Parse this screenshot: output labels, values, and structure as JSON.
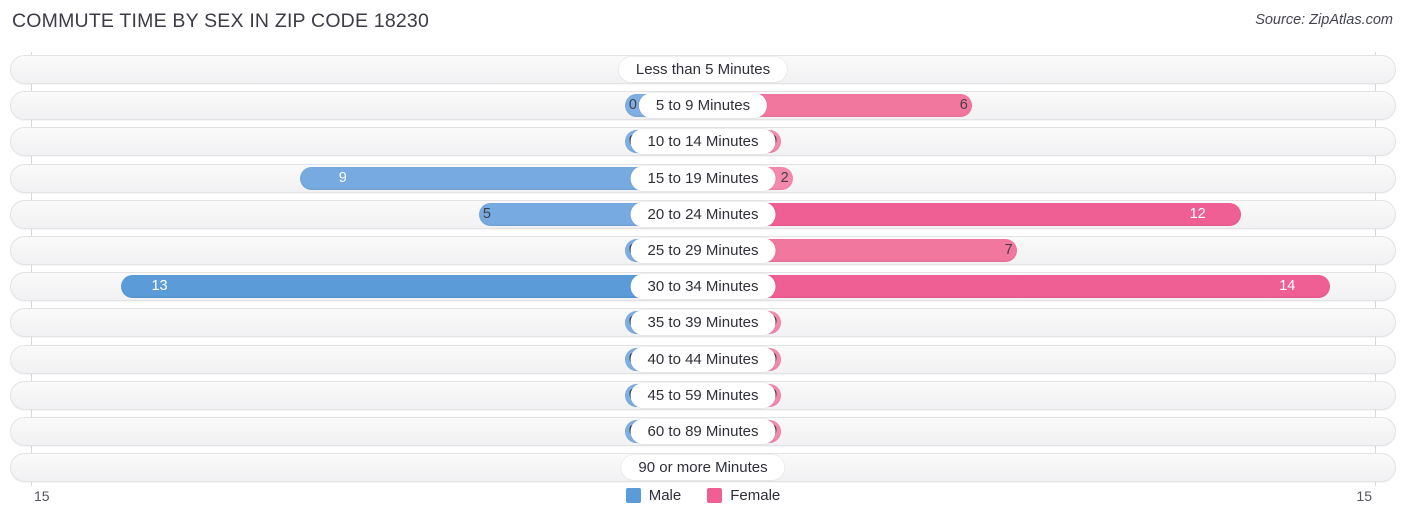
{
  "header": {
    "title": "COMMUTE TIME BY SEX IN ZIP CODE 18230",
    "source": "Source: ZipAtlas.com"
  },
  "legend": {
    "male_label": "Male",
    "female_label": "Female",
    "male_color": "#5b9bd8",
    "female_color": "#ef5f93"
  },
  "axis": {
    "left_max": "15",
    "right_max": "15",
    "max_value": 15
  },
  "chart_data": {
    "type": "bar",
    "title": "COMMUTE TIME BY SEX IN ZIP CODE 18230",
    "subtitle": "Source: ZipAtlas.com",
    "orientation": "horizontal-diverging",
    "xlabel": "",
    "ylabel": "",
    "xlim": [
      15,
      15
    ],
    "grid": false,
    "legend_position": "bottom-center",
    "categories": [
      "Less than 5 Minutes",
      "5 to 9 Minutes",
      "10 to 14 Minutes",
      "15 to 19 Minutes",
      "20 to 24 Minutes",
      "25 to 29 Minutes",
      "30 to 34 Minutes",
      "35 to 39 Minutes",
      "40 to 44 Minutes",
      "45 to 59 Minutes",
      "60 to 89 Minutes",
      "90 or more Minutes"
    ],
    "series": [
      {
        "name": "Male",
        "values": [
          0,
          0,
          0,
          9,
          5,
          0,
          13,
          0,
          0,
          0,
          0,
          0
        ]
      },
      {
        "name": "Female",
        "values": [
          0,
          6,
          0,
          2,
          12,
          7,
          14,
          0,
          0,
          0,
          0,
          0
        ]
      }
    ]
  },
  "rows": [
    {
      "label": "Less than 5 Minutes",
      "male": "0",
      "female": "0"
    },
    {
      "label": "5 to 9 Minutes",
      "male": "0",
      "female": "6"
    },
    {
      "label": "10 to 14 Minutes",
      "male": "0",
      "female": "0"
    },
    {
      "label": "15 to 19 Minutes",
      "male": "9",
      "female": "2"
    },
    {
      "label": "20 to 24 Minutes",
      "male": "5",
      "female": "12"
    },
    {
      "label": "25 to 29 Minutes",
      "male": "0",
      "female": "7"
    },
    {
      "label": "30 to 34 Minutes",
      "male": "13",
      "female": "14"
    },
    {
      "label": "35 to 39 Minutes",
      "male": "0",
      "female": "0"
    },
    {
      "label": "40 to 44 Minutes",
      "male": "0",
      "female": "0"
    },
    {
      "label": "45 to 59 Minutes",
      "male": "0",
      "female": "0"
    },
    {
      "label": "60 to 89 Minutes",
      "male": "0",
      "female": "0"
    },
    {
      "label": "90 or more Minutes",
      "male": "0",
      "female": "0"
    }
  ]
}
